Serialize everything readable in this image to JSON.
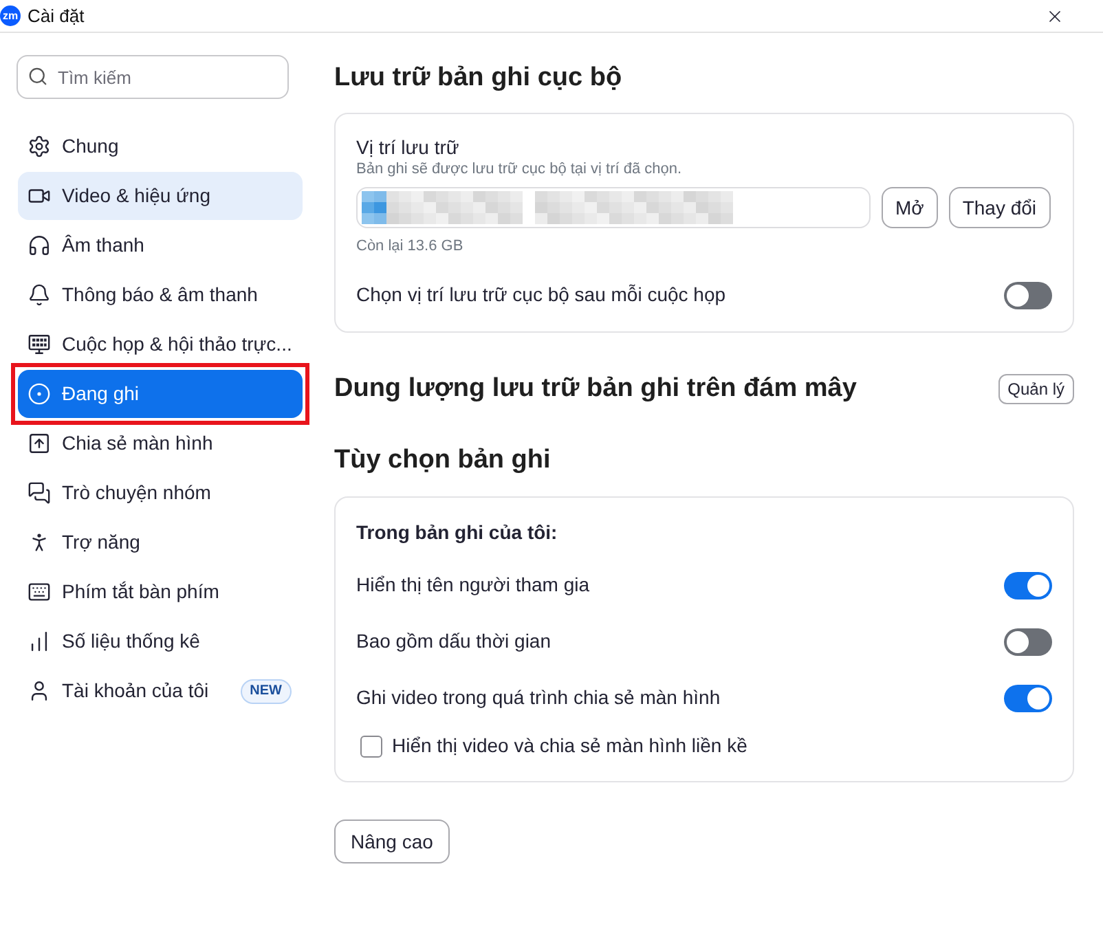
{
  "window": {
    "logo_text": "zm",
    "title": "Cài đặt"
  },
  "sidebar": {
    "search": {
      "placeholder": "Tìm kiếm"
    },
    "items": [
      {
        "label": "Chung",
        "selected": false,
        "hovered": false,
        "outlined": false
      },
      {
        "label": "Video & hiệu ứng",
        "selected": false,
        "hovered": true,
        "outlined": false
      },
      {
        "label": "Âm thanh",
        "selected": false,
        "hovered": false,
        "outlined": false
      },
      {
        "label": "Thông báo & âm thanh",
        "selected": false,
        "hovered": false,
        "outlined": false
      },
      {
        "label": "Cuộc họp & hội thảo trực...",
        "selected": false,
        "hovered": false,
        "outlined": false
      },
      {
        "label": "Đang ghi",
        "selected": true,
        "hovered": false,
        "outlined": true
      },
      {
        "label": "Chia sẻ màn hình",
        "selected": false,
        "hovered": false,
        "outlined": false
      },
      {
        "label": "Trò chuyện nhóm",
        "selected": false,
        "hovered": false,
        "outlined": false
      },
      {
        "label": "Trợ năng",
        "selected": false,
        "hovered": false,
        "outlined": false
      },
      {
        "label": "Phím tắt bàn phím",
        "selected": false,
        "hovered": false,
        "outlined": false
      },
      {
        "label": "Số liệu thống kê",
        "selected": false,
        "hovered": false,
        "outlined": false
      },
      {
        "label": "Tài khoản của tôi",
        "selected": false,
        "hovered": false,
        "outlined": false,
        "badge": "NEW"
      }
    ]
  },
  "local_storage": {
    "heading": "Lưu trữ bản ghi cục bộ",
    "location_label": "Vị trí lưu trữ",
    "location_hint": "Bản ghi sẽ được lưu trữ cục bộ tại vị trí đã chọn.",
    "buttons": [
      "Mở",
      "Thay đổi"
    ],
    "free_space": "Còn lại 13.6 GB",
    "toggle": {
      "label": "Chọn vị trí lưu trữ cục bộ sau mỗi cuộc họp",
      "on": false
    }
  },
  "cloud_storage": {
    "heading": "Dung lượng lưu trữ bản ghi trên đám mây",
    "button": "Quản lý"
  },
  "recording_options": {
    "heading": "Tùy chọn bản ghi",
    "group_title": "Trong bản ghi của tôi:",
    "options": [
      {
        "kind": "toggle",
        "label": "Hiển thị tên người tham gia",
        "on": true
      },
      {
        "kind": "toggle",
        "label": "Bao gồm dấu thời gian",
        "on": false
      },
      {
        "kind": "toggle",
        "label": "Ghi video trong quá trình chia sẻ màn hình",
        "on": true
      },
      {
        "kind": "checkbox",
        "label": "Hiển thị video và chia sẻ màn hình liền kề",
        "checked": false
      }
    ]
  },
  "advanced_button": "Nâng cao"
}
